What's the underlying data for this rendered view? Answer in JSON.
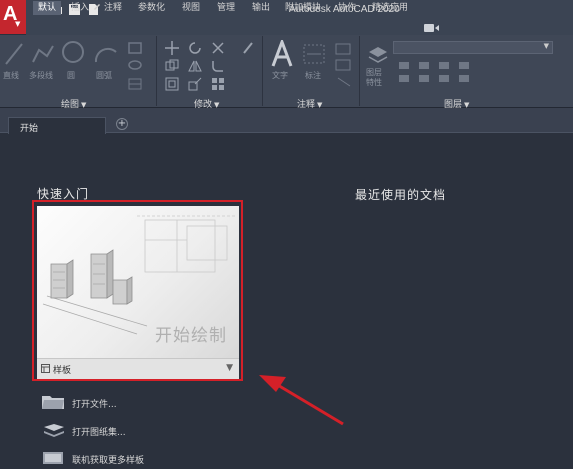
{
  "app": {
    "logo": "A",
    "title": "Autodesk AutoCAD 2020"
  },
  "ribbon_tabs": [
    "默认",
    "插入",
    "注释",
    "参数化",
    "视图",
    "管理",
    "输出",
    "附加模块",
    "协作",
    "精选应用"
  ],
  "ribbon_tools": {
    "line": "直线",
    "polyline": "多段线",
    "circle": "圆",
    "arc": "圆弧",
    "text": "文字",
    "dimension": "标注",
    "layer_props": "图层\n特性"
  },
  "panels": {
    "draw": "绘图",
    "modify": "修改",
    "annotation": "注释",
    "layers": "图层"
  },
  "doc_tab": {
    "label": "开始",
    "new_tab": "+"
  },
  "start_page": {
    "quick_start_title": "快速入门",
    "recent_docs_title": "最近使用的文档",
    "start_drawing": "开始绘制",
    "template_label": "样板",
    "links": [
      "打开文件...",
      "打开图纸集...",
      "联机获取更多样板"
    ]
  },
  "colors": {
    "accent": "#d42028",
    "logo_bg": "#c4262e",
    "background": "#2b313d",
    "ribbon": "#3f4756"
  },
  "icons": [
    "autocad-logo-icon",
    "new-file-icon",
    "open-folder-icon",
    "save-icon",
    "save-as-icon",
    "line-icon",
    "polyline-icon",
    "circle-icon",
    "arc-icon",
    "move-icon",
    "rotate-icon",
    "trim-icon",
    "text-icon",
    "dimension-icon",
    "layer-icon",
    "template-icon",
    "dropdown-arrow-icon",
    "open-folder-icon",
    "sheet-set-icon",
    "more-templates-icon",
    "annotation-arrow"
  ]
}
